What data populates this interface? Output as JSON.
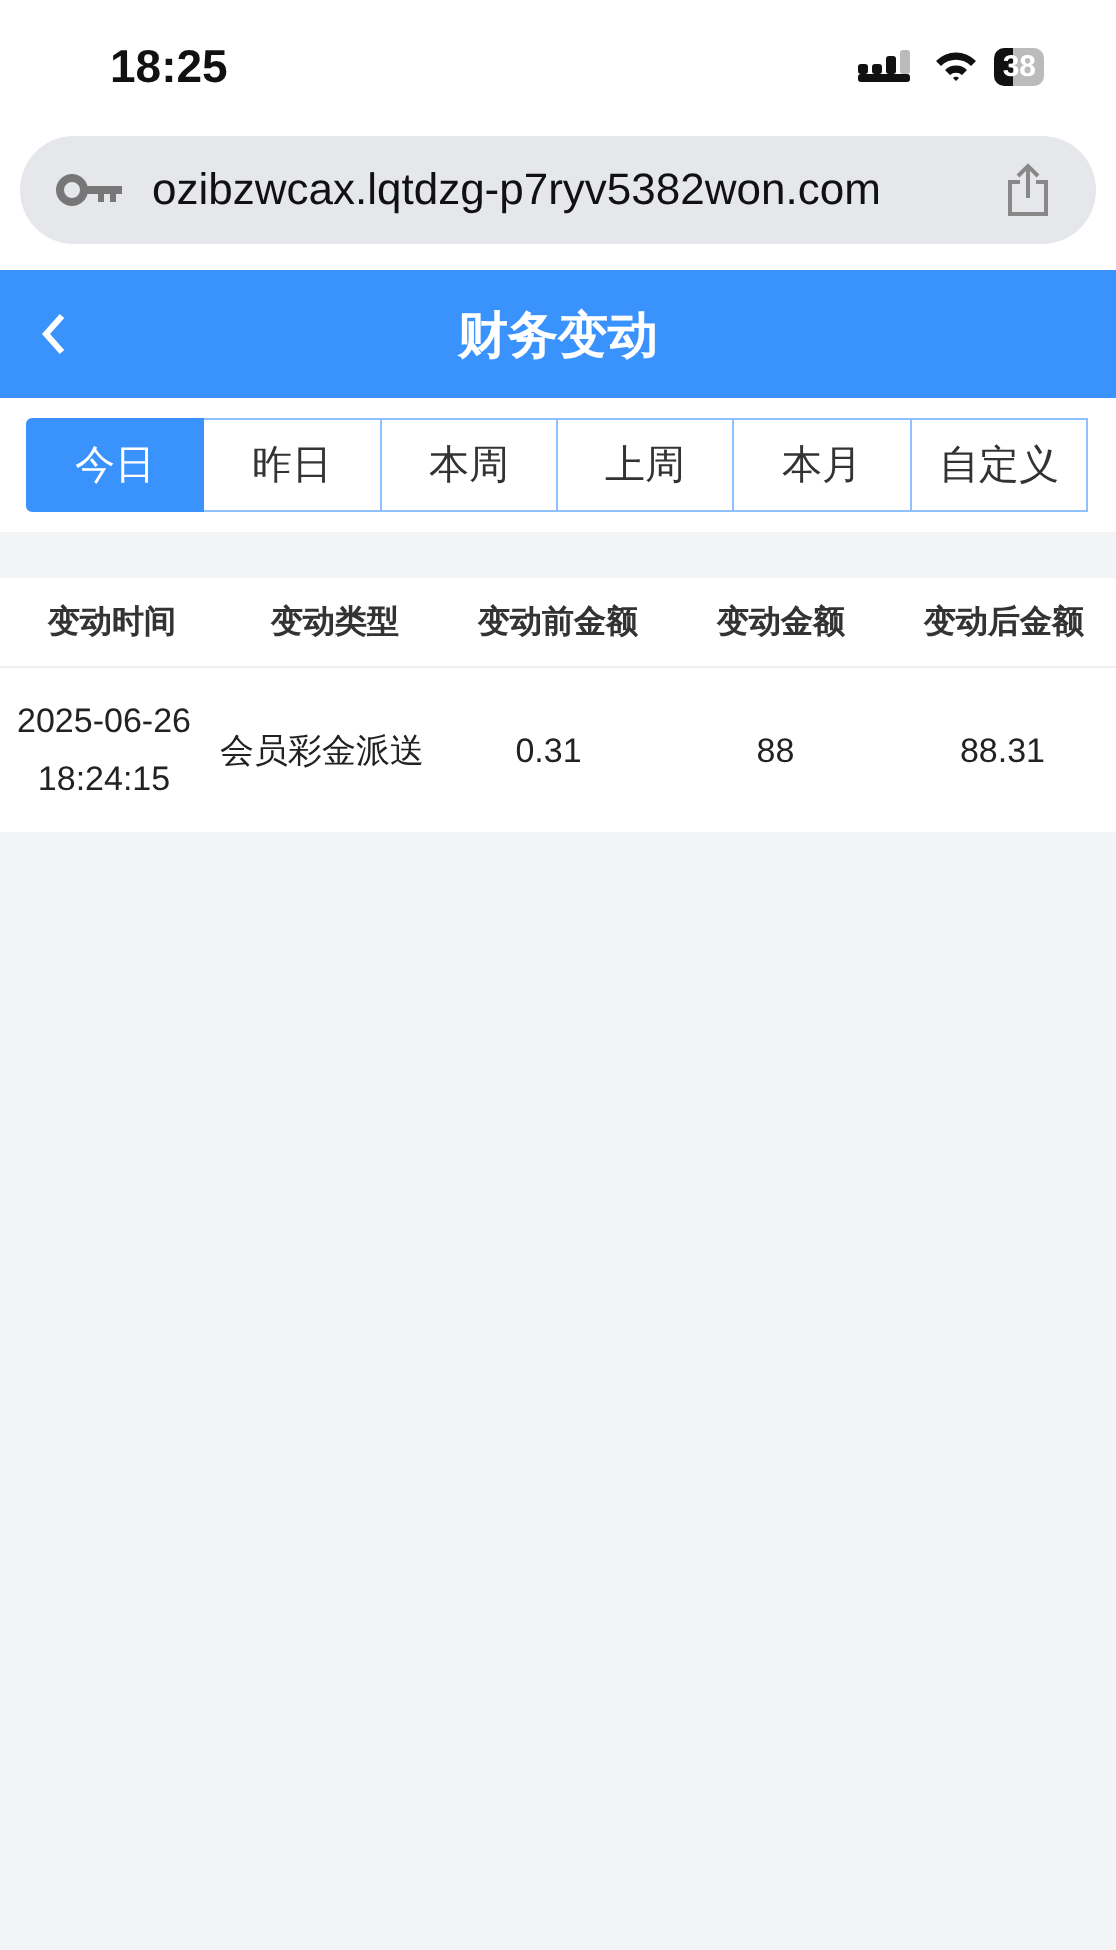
{
  "status_bar": {
    "time": "18:25",
    "battery": "38"
  },
  "address_bar": {
    "url": "ozibzwcax.lqtdzg-p7ryv5382won.com"
  },
  "header": {
    "title": "财务变动"
  },
  "tabs": [
    {
      "label": "今日",
      "selected": true
    },
    {
      "label": "昨日",
      "selected": false
    },
    {
      "label": "本周",
      "selected": false
    },
    {
      "label": "上周",
      "selected": false
    },
    {
      "label": "本月",
      "selected": false
    },
    {
      "label": "自定义",
      "selected": false
    }
  ],
  "table": {
    "columns": [
      "变动时间",
      "变动类型",
      "变动前金额",
      "变动金额",
      "变动后金额"
    ],
    "rows": [
      [
        "2025-06-26 18:24:15",
        "会员彩金派送",
        "0.31",
        "88",
        "88.31"
      ]
    ]
  }
}
